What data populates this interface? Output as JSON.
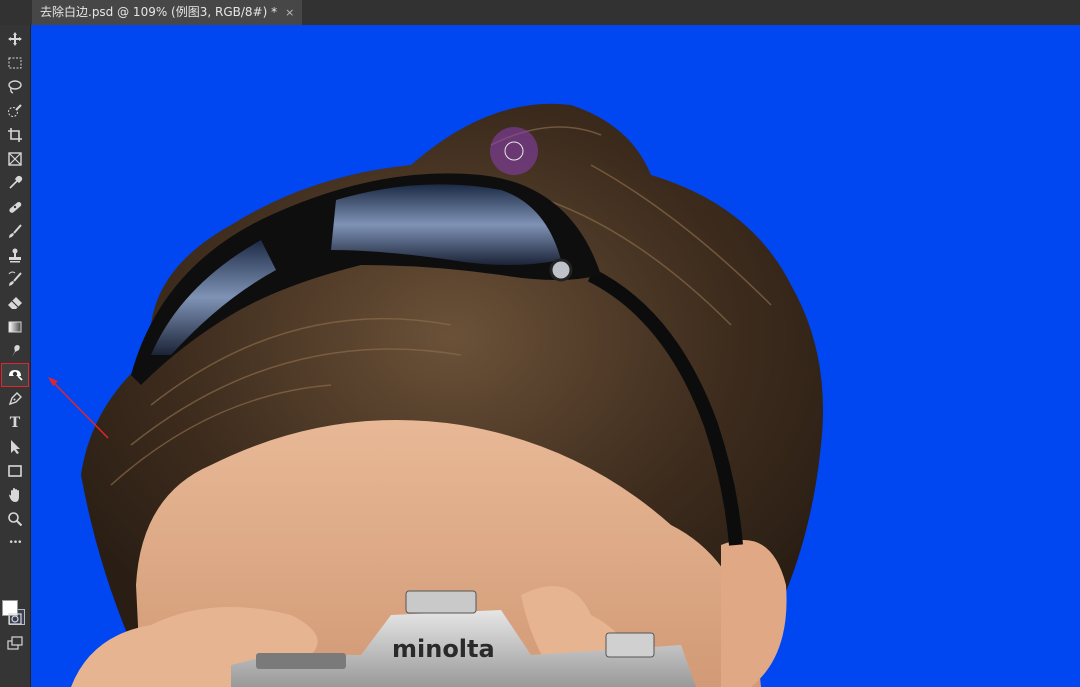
{
  "document": {
    "tab_title": "去除白边.psd @ 109% (例图3, RGB/8#) *",
    "close_glyph": "×"
  },
  "canvas": {
    "background_color": "#0047f2",
    "camera_brand": "minolta"
  },
  "tools": [
    {
      "name": "move-tool",
      "icon": "move-icon"
    },
    {
      "name": "marquee-tool",
      "icon": "rect-marquee-icon"
    },
    {
      "name": "lasso-tool",
      "icon": "lasso-icon"
    },
    {
      "name": "quick-selection-tool",
      "icon": "quick-select-icon"
    },
    {
      "name": "crop-tool",
      "icon": "crop-icon"
    },
    {
      "name": "frame-tool",
      "icon": "frame-icon"
    },
    {
      "name": "eyedropper-tool",
      "icon": "eyedropper-icon"
    },
    {
      "name": "healing-brush-tool",
      "icon": "bandage-icon"
    },
    {
      "name": "brush-tool",
      "icon": "brush-icon"
    },
    {
      "name": "clone-stamp-tool",
      "icon": "stamp-icon"
    },
    {
      "name": "history-brush-tool",
      "icon": "history-brush-icon"
    },
    {
      "name": "eraser-tool",
      "icon": "eraser-icon"
    },
    {
      "name": "gradient-tool",
      "icon": "gradient-icon"
    },
    {
      "name": "smudge-tool",
      "icon": "smudge-icon"
    },
    {
      "name": "burn-tool",
      "icon": "burn-icon",
      "selected": true
    },
    {
      "name": "pen-tool",
      "icon": "pen-icon"
    },
    {
      "name": "type-tool",
      "icon": "type-icon",
      "glyph": "T"
    },
    {
      "name": "path-selection-tool",
      "icon": "arrow-icon"
    },
    {
      "name": "rectangle-tool",
      "icon": "rectangle-icon"
    },
    {
      "name": "hand-tool",
      "icon": "hand-icon"
    },
    {
      "name": "zoom-tool",
      "icon": "zoom-icon"
    },
    {
      "name": "more-tools",
      "icon": "ellipsis-icon",
      "glyph": "•••"
    }
  ],
  "colors": {
    "foreground": "#ffffff",
    "background": "#3a3f55",
    "annotation": "#e0262c"
  }
}
